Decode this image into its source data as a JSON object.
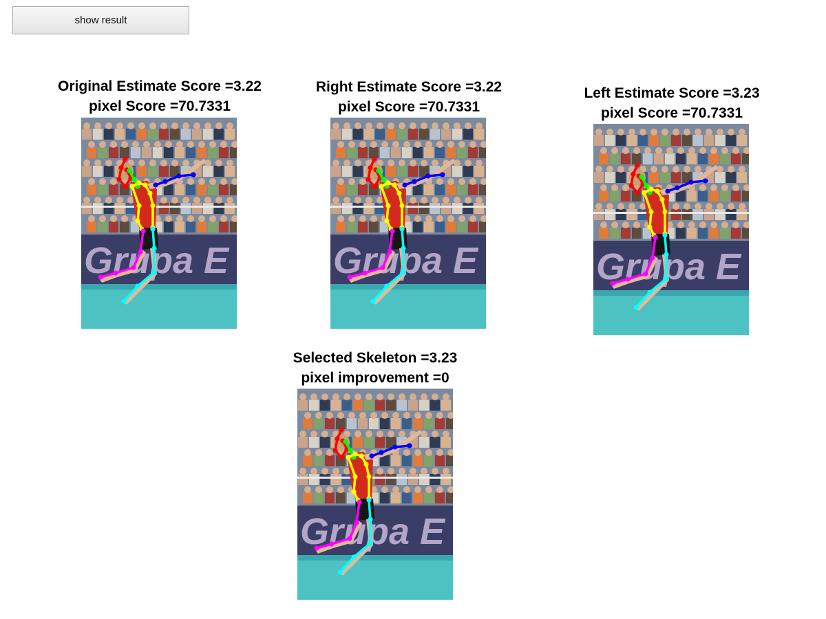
{
  "window": {
    "button_label": "show result"
  },
  "panels": [
    {
      "line1": "Original Estimate Score =3.22",
      "line2": "pixel Score =70.7331"
    },
    {
      "line1": "Right Estimate Score =3.22",
      "line2": "pixel Score =70.7331"
    },
    {
      "line1": "Left Estimate Score =3.23",
      "line2": "pixel Score =70.7331"
    },
    {
      "line1": "Selected Skeleton =3.23",
      "line2": "pixel improvement =0"
    }
  ],
  "skeleton_colors": {
    "head": "#ff0000",
    "neck": "#00ff00",
    "right_arm": "#0000ff",
    "torso": "#ffff00",
    "left_leg": "#ff00ff",
    "right_leg": "#00ffff"
  }
}
